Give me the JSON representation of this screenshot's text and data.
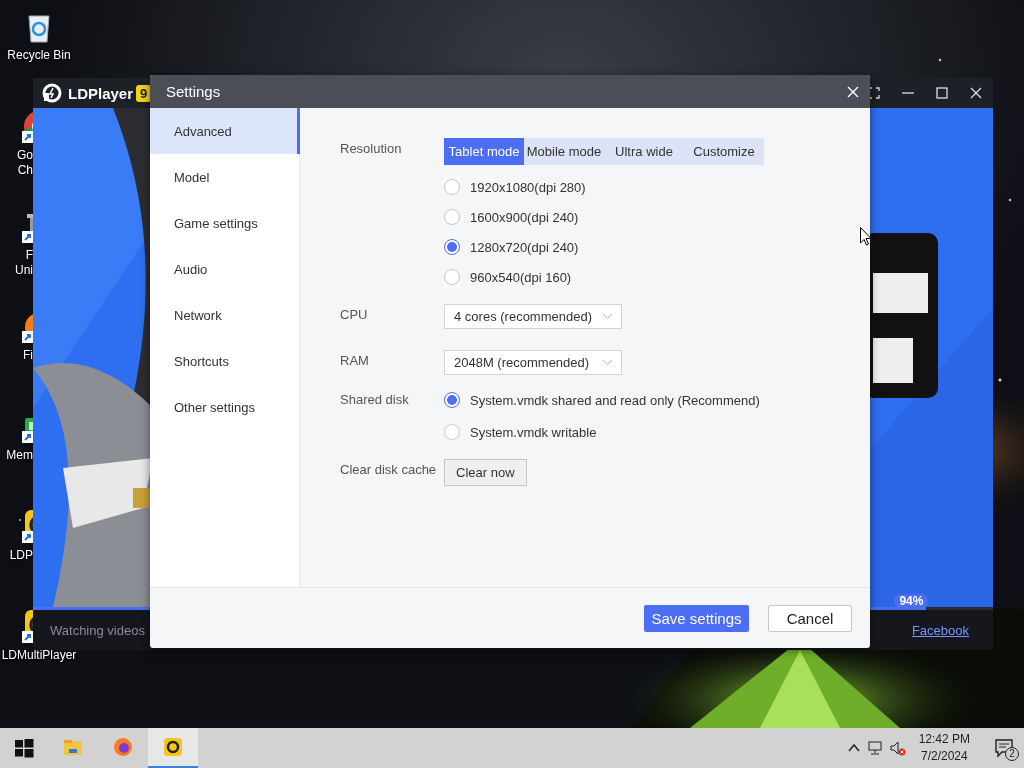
{
  "desktop": {
    "icons": [
      {
        "kind": "recycle",
        "label_lines": [
          "Recycle Bin"
        ],
        "partly_hidden": false,
        "icon_partly_hidden": false
      },
      {
        "kind": "chrome",
        "label_lines": [
          "Go",
          "Ch"
        ],
        "partly_hidden": true,
        "icon_partly_hidden": true
      },
      {
        "kind": "pillar",
        "label_lines": [
          "F",
          "Uni"
        ],
        "partly_hidden": true,
        "icon_partly_hidden": true
      },
      {
        "kind": "firefox",
        "label_lines": [
          "Fi"
        ],
        "partly_hidden": true,
        "icon_partly_hidden": true
      },
      {
        "kind": "memory",
        "label_lines": [
          "Mem"
        ],
        "partly_hidden": true,
        "icon_partly_hidden": true
      },
      {
        "kind": "ld",
        "label_lines": [
          "LDP"
        ],
        "partly_hidden": true,
        "icon_partly_hidden": true
      },
      {
        "kind": "ld",
        "label_lines": [
          "LDMultiPlayer"
        ],
        "partly_hidden": false,
        "icon_partly_hidden": true
      }
    ]
  },
  "emulator": {
    "title": "LDPlayer",
    "version_badge": "9",
    "status_text": "Watching videos",
    "progress": {
      "level": 0.93,
      "reading": "94%"
    },
    "link": "Facebook"
  },
  "settings": {
    "title": "Settings",
    "sidebar": [
      {
        "label": "Advanced",
        "selected": true
      },
      {
        "label": "Model",
        "selected": false
      },
      {
        "label": "Game settings",
        "selected": false
      },
      {
        "label": "Audio",
        "selected": false
      },
      {
        "label": "Network",
        "selected": false
      },
      {
        "label": "Shortcuts",
        "selected": false
      },
      {
        "label": "Other settings",
        "selected": false
      }
    ],
    "resolution": {
      "label": "Resolution",
      "modes": [
        {
          "label": "Tablet mode",
          "selected": true
        },
        {
          "label": "Mobile mode",
          "selected": false
        },
        {
          "label": "Ultra wide",
          "selected": false
        },
        {
          "label": "Customize",
          "selected": false
        }
      ],
      "options": [
        {
          "label": "1920x1080(dpi 280)",
          "selected": false
        },
        {
          "label": "1600x900(dpi 240)",
          "selected": false
        },
        {
          "label": "1280x720(dpi 240)",
          "selected": true
        },
        {
          "label": "960x540(dpi 160)",
          "selected": false
        }
      ]
    },
    "cpu": {
      "label": "CPU",
      "value": "4 cores (recommended)"
    },
    "ram": {
      "label": "RAM",
      "value": "2048M (recommended)"
    },
    "shared_disk": {
      "label": "Shared disk",
      "options": [
        {
          "label": "System.vmdk shared and read only (Recommend)",
          "selected": true
        },
        {
          "label": "System.vmdk writable",
          "selected": false
        }
      ]
    },
    "clear_cache": {
      "label": "Clear disk cache",
      "button": "Clear now"
    },
    "buttons": [
      {
        "label": "Save settings",
        "kind": "primary"
      },
      {
        "label": "Cancel",
        "kind": "secondary"
      }
    ]
  },
  "taskbar": {
    "apps": [
      {
        "kind": "explorer",
        "selected": false
      },
      {
        "kind": "firefox",
        "selected": false
      },
      {
        "kind": "ldplayer",
        "selected": true
      }
    ],
    "time": "12:42 PM",
    "date": "7/2/2024",
    "notification_count": "2"
  }
}
